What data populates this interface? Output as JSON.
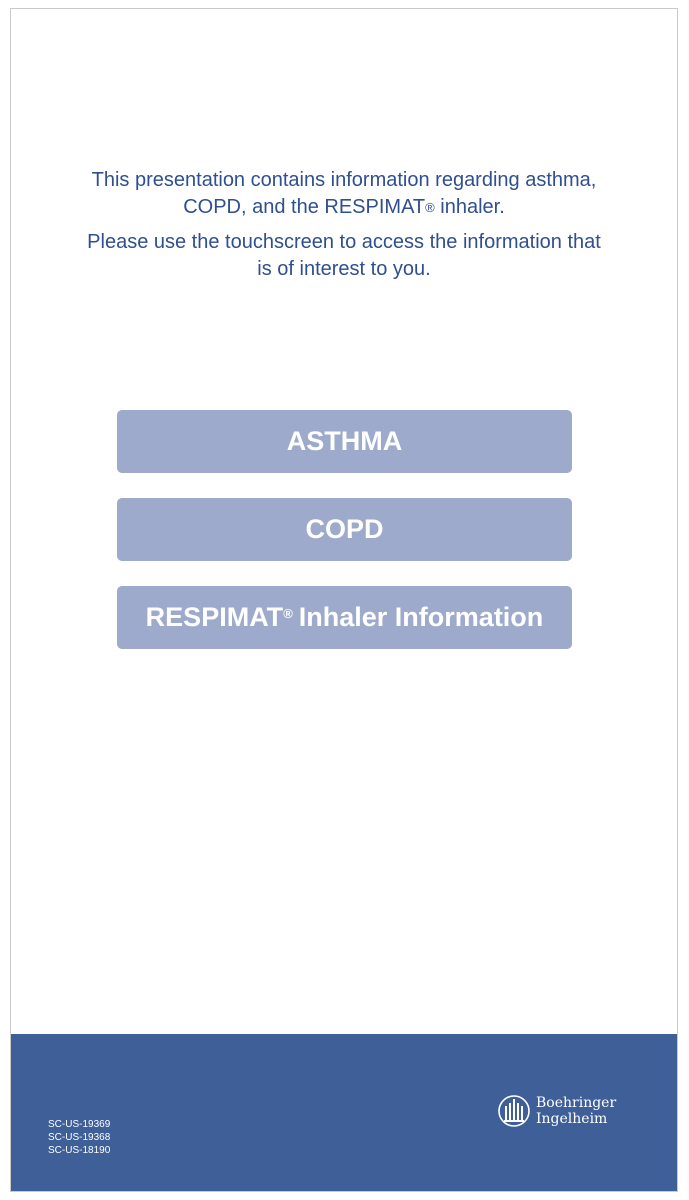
{
  "intro": {
    "line1": "This presentation contains information regarding asthma, COPD, and the RESPIMAT",
    "line1_mark": "®",
    "line1_end": " inhaler.",
    "line2": "Please use the touchscreen to access the information that is of interest to you."
  },
  "menu": {
    "asthma_label": "ASTHMA",
    "copd_label": "COPD",
    "respimat_label": "RESPIMAT",
    "respimat_mark": "®",
    "respimat_suffix": "Inhaler Information"
  },
  "footer": {
    "codes": [
      "SC-US-19369",
      "SC-US-19368",
      "SC-US-18190"
    ],
    "logo_line1": "Boehringer",
    "logo_line2": "Ingelheim",
    "logo_icon": "boehringer-ingelheim-logo-icon"
  },
  "colors": {
    "text_blue": "#2f4f91",
    "button": "#9eaacc",
    "footer": "#3e5f98"
  }
}
